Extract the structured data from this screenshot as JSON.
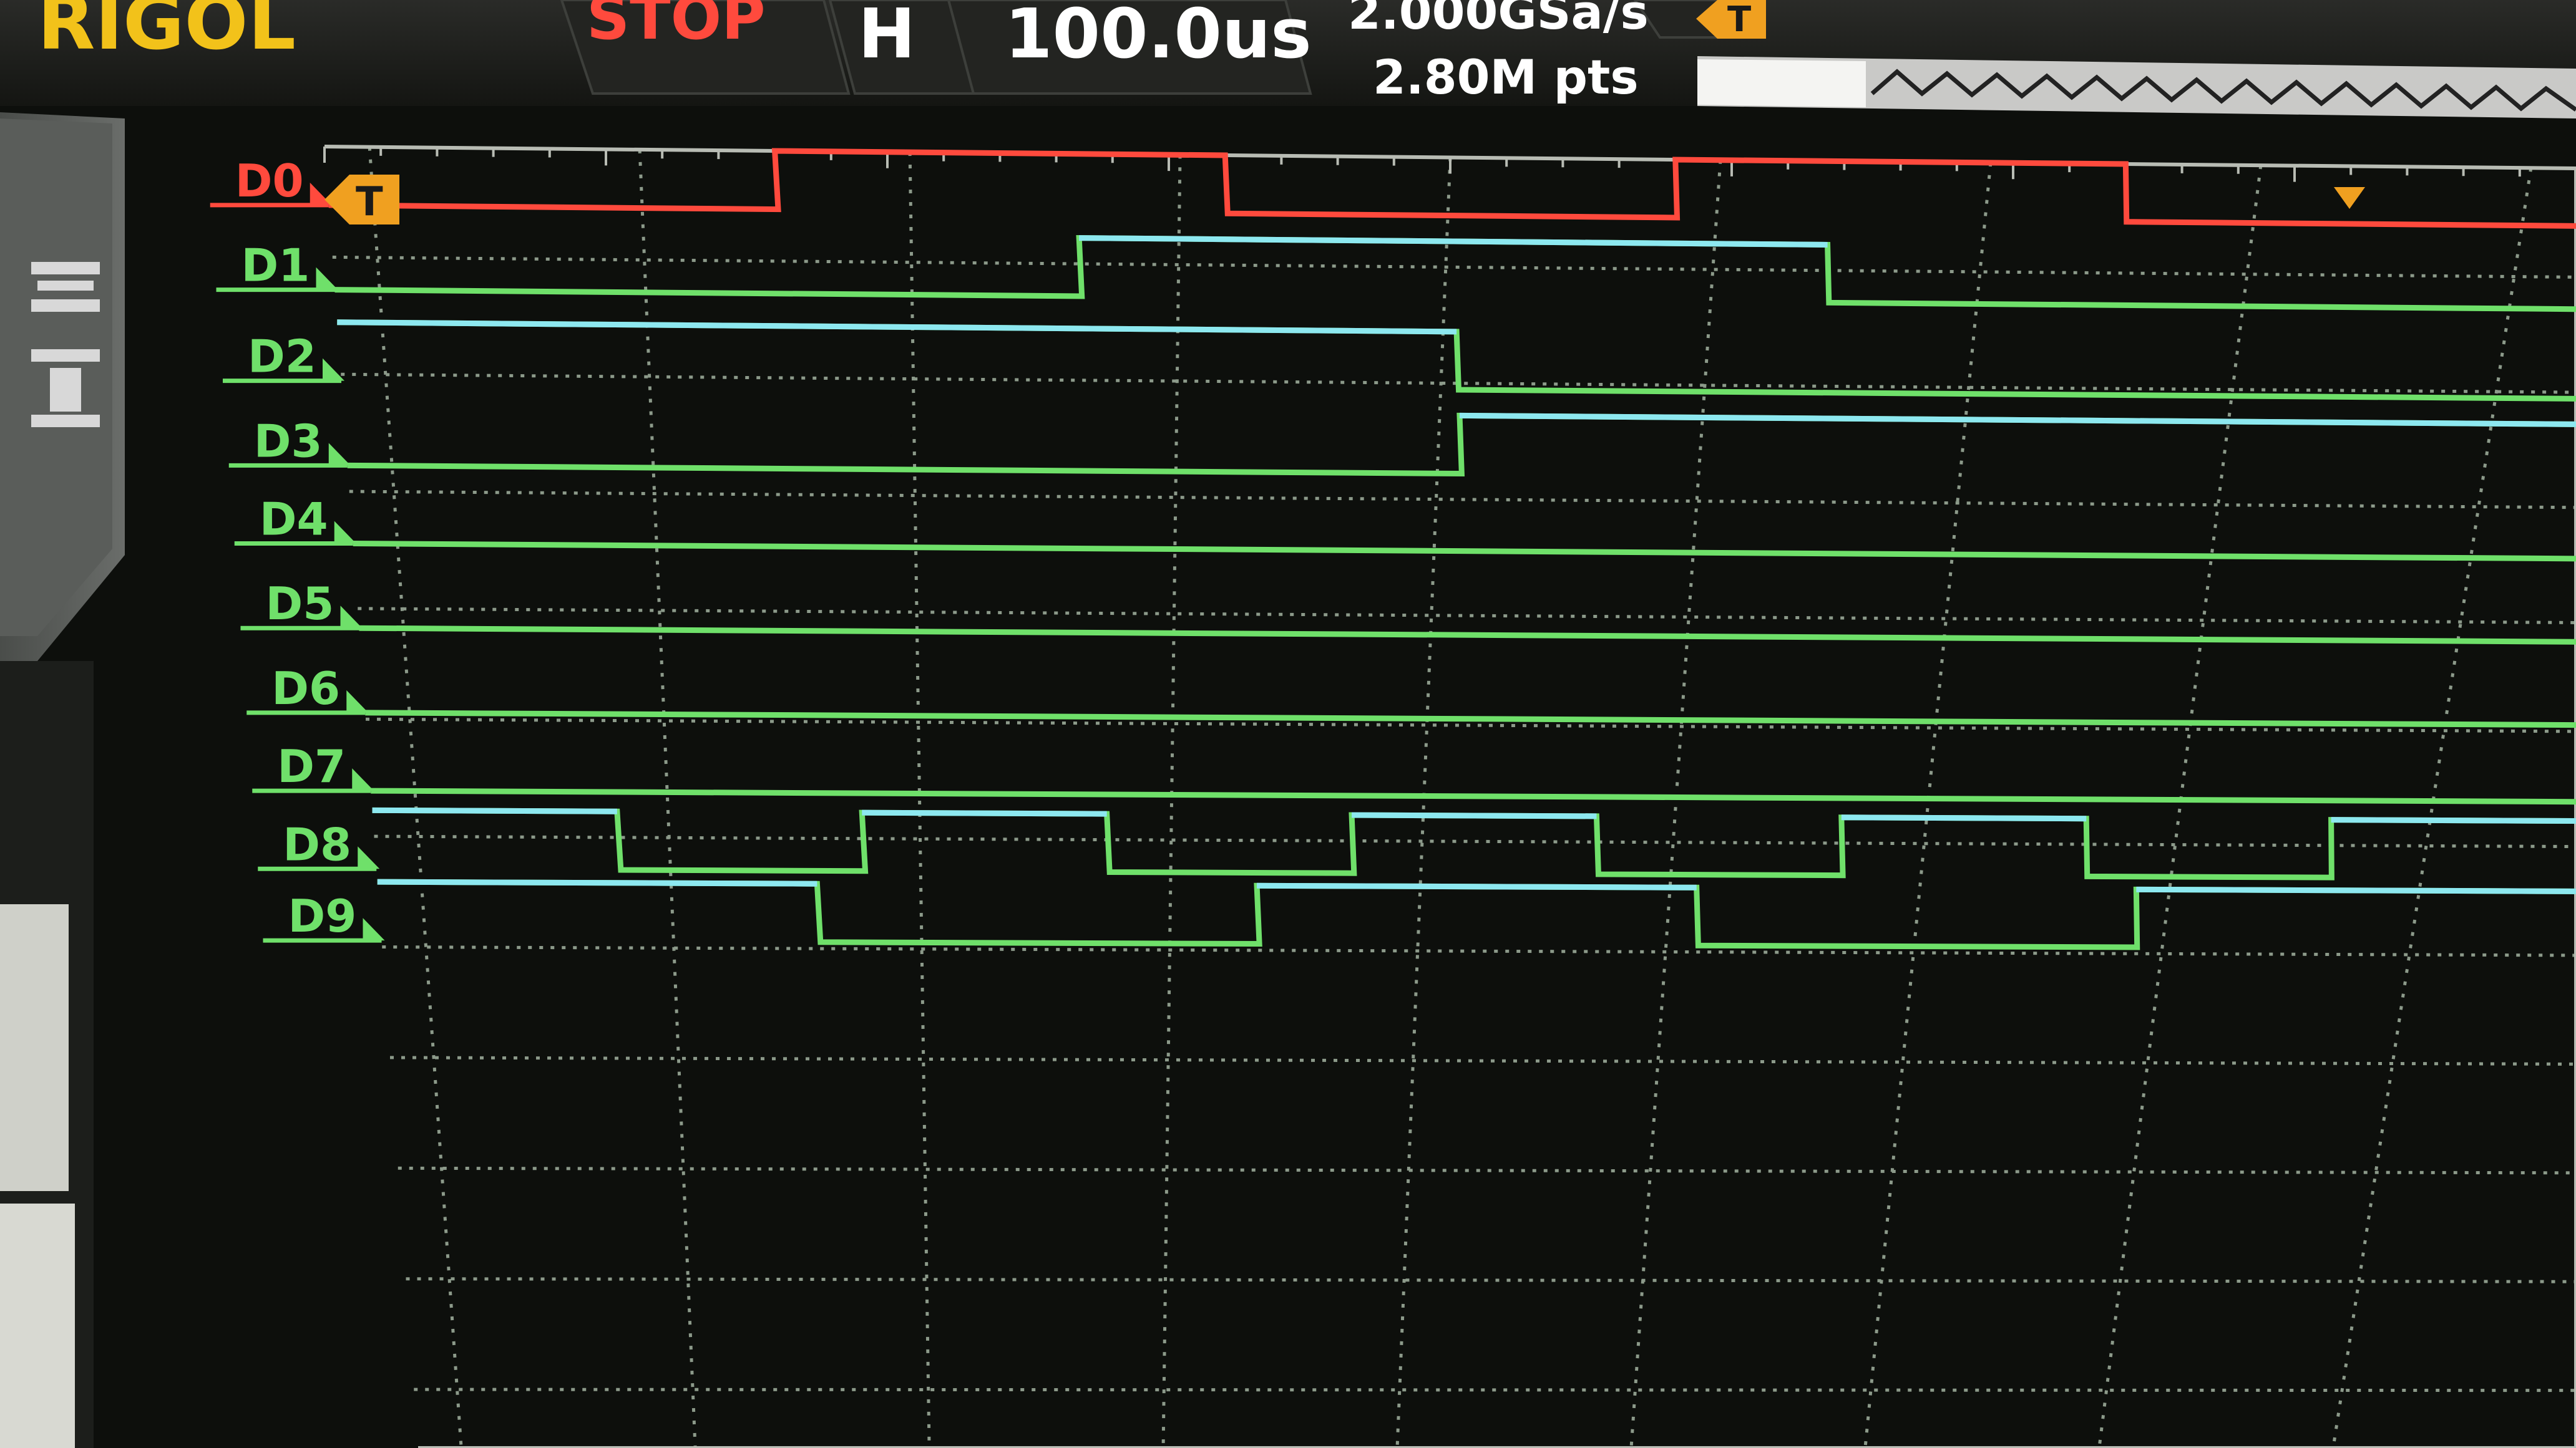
{
  "header": {
    "brand": "RIGOL",
    "run_state": "STOP",
    "horizontal_label": "H",
    "timebase": "100.0us",
    "sample_rate": "2.000GSa/s",
    "memory_depth": "2.80M pts",
    "trigger_marker": "T"
  },
  "channels": [
    {
      "label": "D0",
      "color": "#ff4a3d",
      "bits": [
        0,
        1,
        0,
        1,
        0
      ]
    },
    {
      "label": "D1",
      "color": "#6fe06a",
      "bits": [
        0,
        1,
        0
      ]
    },
    {
      "label": "D2",
      "color": "#6fe06a",
      "bits": [
        1,
        0
      ]
    },
    {
      "label": "D3",
      "color": "#6fe06a",
      "bits": [
        0,
        1
      ]
    },
    {
      "label": "D4",
      "color": "#6fe06a",
      "bits": [
        0
      ]
    },
    {
      "label": "D5",
      "color": "#6fe06a",
      "bits": [
        0
      ]
    },
    {
      "label": "D6",
      "color": "#6fe06a",
      "bits": [
        0
      ]
    },
    {
      "label": "D7",
      "color": "#6fe06a",
      "bits": [
        0
      ]
    },
    {
      "label": "D8",
      "color": "#6fe06a",
      "bits": [
        1,
        0,
        1,
        0,
        1,
        0,
        1,
        0,
        1
      ]
    },
    {
      "label": "D9",
      "color": "#6fe06a",
      "bits": [
        1,
        0,
        1,
        0,
        1
      ]
    }
  ],
  "colors": {
    "background": "#0d0f0c",
    "grid": "#8c9a8a",
    "brand": "#f2c21a",
    "stop": "#ff4a3d",
    "high_level": "#8de8f0",
    "low_level": "#6fe06a",
    "trigger_badge": "#f0a020"
  }
}
